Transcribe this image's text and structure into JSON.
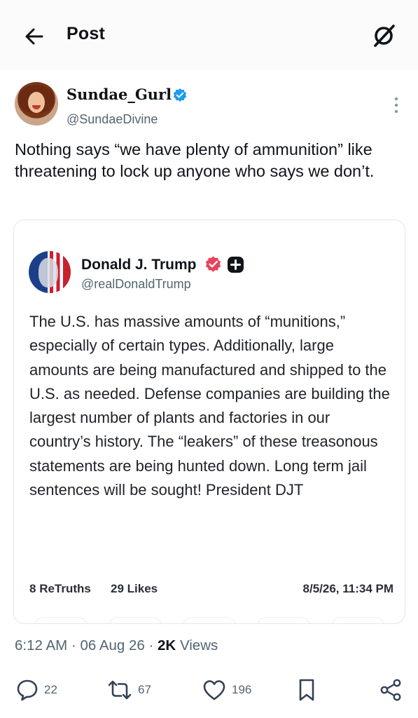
{
  "header": {
    "title": "Post",
    "back_icon": "arrow-left-icon",
    "grok_icon": "grok-icon"
  },
  "post": {
    "author_name": "Sundae_Gurl",
    "author_handle": "@SundaeDivine",
    "verified": true,
    "text": "Nothing says “we have plenty of ammunition” like threatening to lock up anyone who says we don’t.",
    "time": "6:12 AM",
    "date": "06 Aug 26",
    "views_count": "2K",
    "views_label": "Views",
    "replies": "22",
    "reposts": "67",
    "likes": "196"
  },
  "quote": {
    "author_name": "Donald J. Trump",
    "author_handle": "@realDonaldTrump",
    "body": "The U.S. has massive amounts of “munitions,” especially of certain types. Additionally, large amounts are being manufactured and shipped to the U.S. as needed. Defense companies are building the largest number of plants and factories in our country’s history. The “leakers” of these treasonous statements are being hunted down. Long term jail sentences will be sought! President DJT",
    "retruths_count": "8",
    "retruths_label": "ReTruths",
    "likes_count": "29",
    "likes_label": "Likes",
    "timestamp": "8/5/26, 11:34 PM"
  },
  "colors": {
    "verified_blue": "#1d9bf0",
    "truth_badge_pink": "#e8435a",
    "secondary_text": "#536471"
  }
}
